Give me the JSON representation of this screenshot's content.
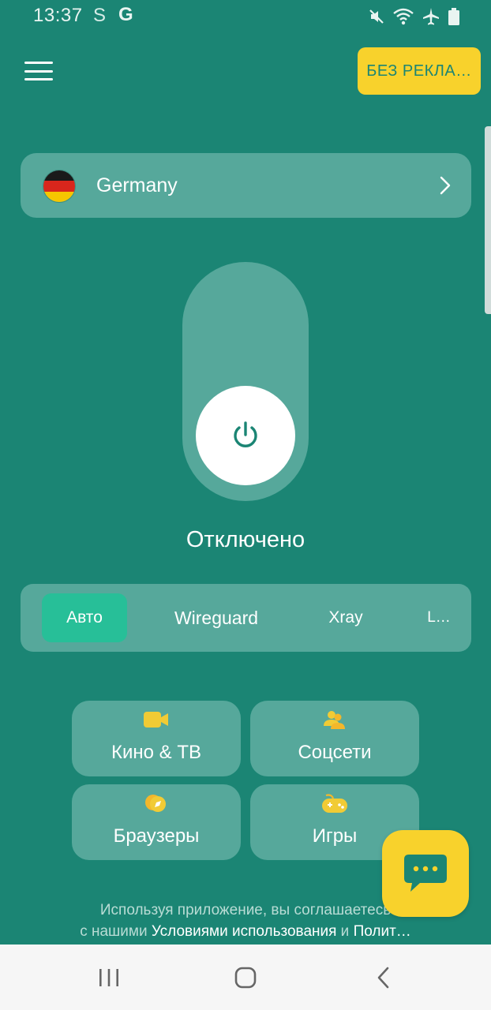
{
  "status_bar": {
    "time": "13:37",
    "letter_s": "S",
    "letter_g": "G",
    "icons": [
      "mute-icon",
      "wifi-icon",
      "airplane-icon",
      "battery-icon"
    ]
  },
  "header": {
    "no_ads_label": "БЕЗ РЕКЛА…"
  },
  "country": {
    "name": "Germany",
    "flag_colors": [
      "#1a1a1a",
      "#d9261c",
      "#f6c600"
    ]
  },
  "connection": {
    "status": "Отключено"
  },
  "protocols": {
    "tabs": [
      {
        "label": "Авто",
        "active": true
      },
      {
        "label": "Wireguard",
        "active": false
      },
      {
        "label": "Xray",
        "active": false
      },
      {
        "label": "L…",
        "active": false
      }
    ]
  },
  "categories": [
    {
      "label": "Кино & ТВ",
      "icon": "camera-icon"
    },
    {
      "label": "Соцсети",
      "icon": "people-icon"
    },
    {
      "label": "Браузеры",
      "icon": "compass-icon"
    },
    {
      "label": "Игры",
      "icon": "gamepad-icon"
    }
  ],
  "terms": {
    "line1": "Используя приложение, вы соглашаетесь",
    "line2_prefix": "с нашими ",
    "terms_link": "Условиями использования",
    "line2_and": " и ",
    "privacy_link": "Полит…"
  },
  "colors": {
    "background": "#1b8574",
    "card": "#56a89b",
    "accent_yellow": "#f8d22c",
    "active_tab": "#27bf98"
  }
}
